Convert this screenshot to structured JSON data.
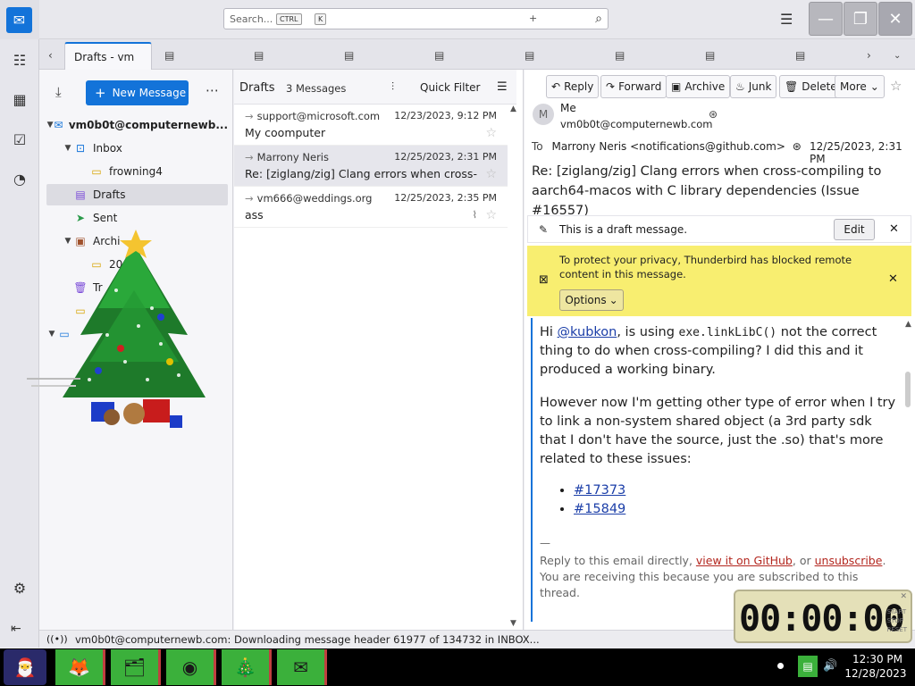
{
  "search": {
    "placeholder": "Search...",
    "key1": "CTRL",
    "plus": "+",
    "key2": "K"
  },
  "tabs": {
    "active_label": "Drafts - vm"
  },
  "folder_pane": {
    "new_message": "New Message",
    "account": "vm0b0t@computernewb...",
    "folders": [
      {
        "label": "Inbox"
      },
      {
        "label": "frowning4"
      },
      {
        "label": "Drafts"
      },
      {
        "label": "Sent"
      },
      {
        "label": "Archi"
      },
      {
        "label": "20"
      },
      {
        "label": "Tr"
      }
    ]
  },
  "message_list": {
    "title": "Drafts",
    "count": "3 Messages",
    "quick_filter": "Quick Filter",
    "messages": [
      {
        "from": "support@microsoft.com",
        "date": "12/23/2023, 9:12 PM",
        "subject": "My coomputer"
      },
      {
        "from": "Marrony Neris",
        "date": "12/25/2023, 2:31 PM",
        "subject": "Re: [ziglang/zig] Clang errors when cross-..."
      },
      {
        "from": "vm666@weddings.org",
        "date": "12/25/2023, 2:35 PM",
        "subject": "ass"
      }
    ]
  },
  "header": {
    "buttons": {
      "reply": "Reply",
      "forward": "Forward",
      "archive": "Archive",
      "junk": "Junk",
      "delete": "Delete",
      "more": "More"
    },
    "avatar_letter": "M",
    "from_name": "Me",
    "from_addr": "vm0b0t@computernewb.com",
    "to_label": "To",
    "to": "Marrony Neris <notifications@github.com>",
    "date": "12/25/2023, 2:31 PM",
    "subject": "Re: [ziglang/zig] Clang errors when cross-compiling to aarch64-macos with C library dependencies (Issue #16557)"
  },
  "draft_bar": {
    "text": "This is a draft message.",
    "edit": "Edit"
  },
  "privacy_bar": {
    "text": "To protect your privacy, Thunderbird has blocked remote content in this message.",
    "options": "Options"
  },
  "body": {
    "hi": "Hi ",
    "mention": "@kubkon",
    "p1a": ", is using ",
    "code": "exe.linkLibC()",
    "p1b": " not the correct thing to do when cross-compiling? I did this and it produced a working binary.",
    "p2": "However now I'm getting other type of error when I try to link a non-system shared object (a 3rd party sdk that I don't have the source, just the .so) that's more related to these issues:",
    "links": [
      "#17373",
      "#15849"
    ],
    "sep": "—",
    "foot1": "Reply to this email directly, ",
    "foot_link1": "view it on GitHub",
    "foot2": ", or ",
    "foot_link2": "unsubscribe",
    "foot3": ".",
    "foot4": "You are receiving this because you are subscribed to this thread."
  },
  "status": {
    "text": "vm0b0t@computernewb.com: Downloading message header 61977 of 134732 in INBOX..."
  },
  "timer": {
    "digits": "00:00:00",
    "side1": "START",
    "side2": "STOP",
    "side3": "RESET"
  },
  "taskbar": {
    "time": "12:30 PM",
    "date": "12/28/2023"
  },
  "colors": {
    "accent": "#1373d9",
    "privacy_bar": "#f8ee70",
    "taskbar_app": "#3bb03b"
  },
  "icons": [
    "mail-icon",
    "address-book-icon",
    "calendar-icon",
    "tasks-icon",
    "chat-icon",
    "settings-icon",
    "collapse-icon",
    "get-messages-icon",
    "search-icon",
    "star-icon",
    "attachment-icon"
  ]
}
